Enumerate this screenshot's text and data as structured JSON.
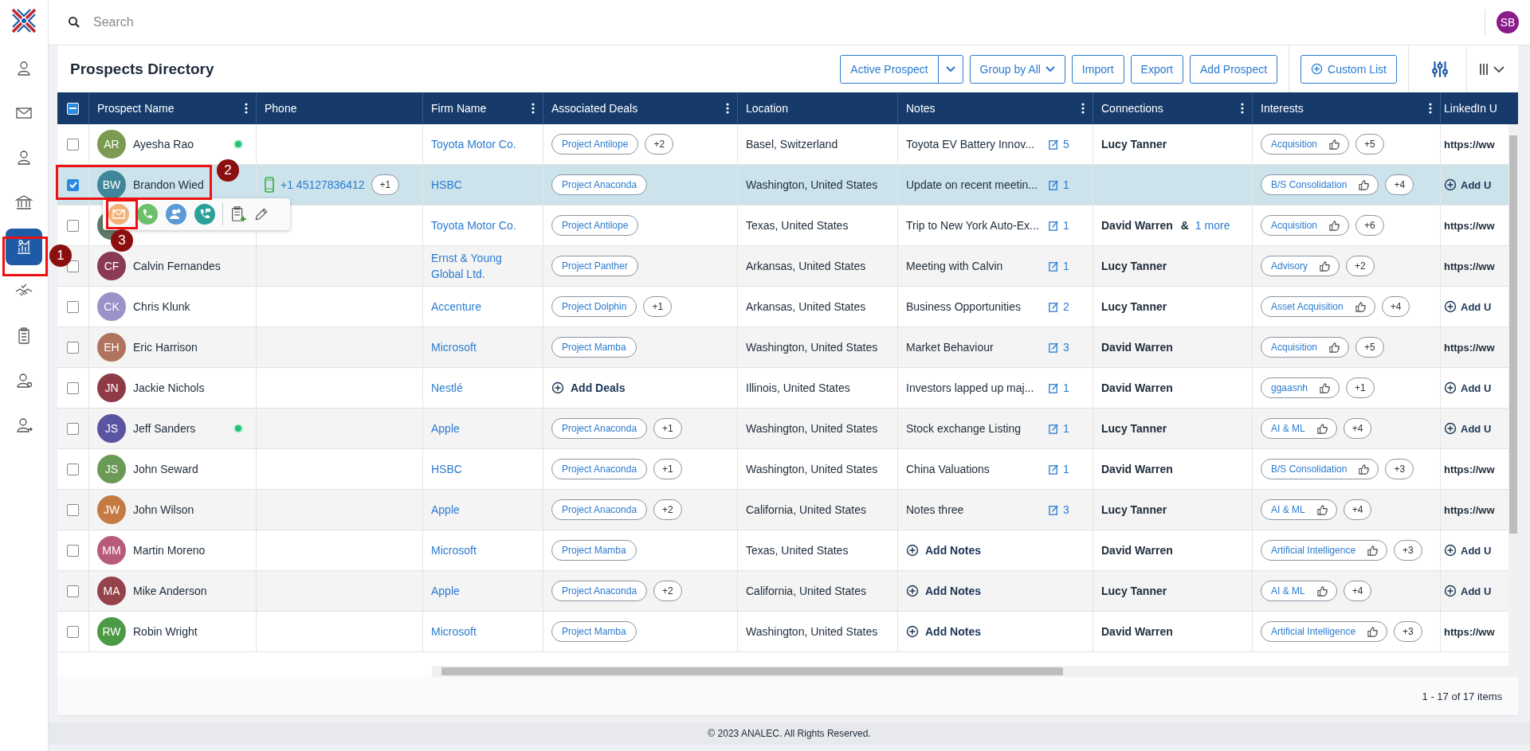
{
  "search": {
    "placeholder": "Search"
  },
  "user": {
    "initials": "SB"
  },
  "sidebar": {
    "items": [
      {
        "kind": "user-gear",
        "selected": false
      },
      {
        "kind": "mail",
        "selected": false
      },
      {
        "kind": "user",
        "selected": false
      },
      {
        "kind": "bank",
        "selected": false
      },
      {
        "kind": "chart",
        "selected": true
      },
      {
        "kind": "handshake",
        "selected": false
      },
      {
        "kind": "clipboard",
        "selected": false
      },
      {
        "kind": "user-settings",
        "selected": false
      },
      {
        "kind": "user-share",
        "selected": false
      }
    ]
  },
  "page": {
    "title": "Prospects Directory"
  },
  "toolbar": [
    {
      "kind": "split",
      "label": "Active Prospect"
    },
    {
      "kind": "dropdown",
      "label": "Group by All"
    },
    {
      "kind": "plain",
      "label": "Import"
    },
    {
      "kind": "plain",
      "label": "Export"
    },
    {
      "kind": "plain",
      "label": "Add Prospect"
    },
    {
      "kind": "add",
      "label": "Custom List"
    },
    {
      "kind": "filter"
    },
    {
      "kind": "columns"
    }
  ],
  "table": {
    "header_partial": true,
    "columns": [
      {
        "label": "Prospect Name",
        "menu": true
      },
      {
        "label": "Phone",
        "menu": false
      },
      {
        "label": "Firm Name",
        "menu": true
      },
      {
        "label": "Associated Deals",
        "menu": true
      },
      {
        "label": "Location",
        "menu": false
      },
      {
        "label": "Notes",
        "menu": true
      },
      {
        "label": "Connections",
        "menu": true
      },
      {
        "label": "Interests",
        "menu": true
      },
      {
        "label": "LinkedIn U",
        "menu": false
      }
    ],
    "rows": [
      {
        "checked": false,
        "initials": "AR",
        "color": "#7b9b50",
        "name": "Ayesha Rao",
        "online": true,
        "firm": "Toyota Motor Co.",
        "deal": "Project Antilope",
        "deal_more": "+2",
        "location": "Basel, Switzerland",
        "note": "Toyota EV Battery Innov...",
        "note_count": "5",
        "connection": "Lucy Tanner",
        "interest": "Acquisition",
        "interest_more": "+5",
        "linkedin": {
          "kind": "url",
          "text": "https://ww"
        }
      },
      {
        "checked": true,
        "initials": "BW",
        "color": "#3f8798",
        "name": "Brandon Wied",
        "online": false,
        "phone": "+1 45127836412",
        "phone_more": "+1",
        "firm": "HSBC",
        "deal": "Project Anaconda",
        "location": "Washington, United States",
        "note": "Update on recent meetin...",
        "note_count": "1",
        "interest": "B/S Consolidation",
        "interest_more": "+4",
        "linkedin": {
          "kind": "add",
          "text": "Add U"
        }
      },
      {
        "checked": false,
        "color": "#5f7a6a",
        "online": false,
        "firm": "Toyota Motor Co.",
        "deal": "Project Antilope",
        "location": "Texas, United States",
        "note": "Trip to New York Auto-Ex...",
        "note_count": "1",
        "connection": "David Warren",
        "connection_more": {
          "joiner": "&",
          "link": "1 more"
        },
        "interest": "Acquisition",
        "interest_more": "+6",
        "linkedin": {
          "kind": "url",
          "text": "https://ww"
        }
      },
      {
        "checked": false,
        "initials": "CF",
        "color": "#8a3a55",
        "name": "Calvin Fernandes",
        "online": false,
        "firm": "Ernst & Young Global Ltd.",
        "deal": "Project Panther",
        "location": "Arkansas, United States",
        "note": "Meeting with Calvin",
        "note_count": "1",
        "connection": "Lucy Tanner",
        "interest": "Advisory",
        "interest_more": "+2",
        "linkedin": {
          "kind": "url",
          "text": "https://ww"
        }
      },
      {
        "checked": false,
        "initials": "CK",
        "color": "#9a92c8",
        "name": "Chris Klunk",
        "online": false,
        "firm": "Accenture",
        "deal": "Project Dolphin",
        "deal_more": "+1",
        "location": "Arkansas, United States",
        "note": "Business Opportunities",
        "note_count": "2",
        "connection": "Lucy Tanner",
        "interest": "Asset Acquisition",
        "interest_more": "+4",
        "linkedin": {
          "kind": "add",
          "text": "Add U"
        }
      },
      {
        "checked": false,
        "initials": "EH",
        "color": "#b0735e",
        "name": "Eric Harrison",
        "online": false,
        "firm": "Microsoft",
        "deal": "Project Mamba",
        "location": "Washington, United States",
        "note": "Market Behaviour",
        "note_count": "3",
        "connection": "David Warren",
        "interest": "Acquisition",
        "interest_more": "+5",
        "linkedin": {
          "kind": "url",
          "text": "https://ww"
        }
      },
      {
        "checked": false,
        "initials": "JN",
        "color": "#8e3b45",
        "name": "Jackie Nichols",
        "online": false,
        "firm": "Nestlé",
        "deal_add": "Add Deals",
        "location": "Illinois, United States",
        "note": "Investors lapped up maj...",
        "note_count": "1",
        "connection": "David Warren",
        "interest": "ggaasnh",
        "interest_more": "+1",
        "linkedin": {
          "kind": "add",
          "text": "Add U"
        }
      },
      {
        "checked": false,
        "initials": "JS",
        "color": "#5a55a0",
        "name": "Jeff Sanders",
        "online": true,
        "firm": "Apple",
        "deal": "Project Anaconda",
        "deal_more": "+1",
        "location": "Washington, United States",
        "note": "Stock exchange Listing",
        "note_count": "1",
        "connection": "Lucy Tanner",
        "interest": "AI & ML",
        "interest_more": "+4",
        "linkedin": {
          "kind": "add",
          "text": "Add U"
        }
      },
      {
        "checked": false,
        "initials": "JS",
        "color": "#6b9a57",
        "name": "John Seward",
        "online": false,
        "firm": "HSBC",
        "deal": "Project Anaconda",
        "deal_more": "+1",
        "location": "Washington, United States",
        "note": "China Valuations",
        "note_count": "1",
        "connection": "David Warren",
        "interest": "B/S Consolidation",
        "interest_more": "+3",
        "linkedin": {
          "kind": "url",
          "text": "https://ww"
        }
      },
      {
        "checked": false,
        "initials": "JW",
        "color": "#c47a42",
        "name": "John Wilson",
        "online": false,
        "firm": "Apple",
        "deal": "Project Anaconda",
        "deal_more": "+2",
        "location": "California, United States",
        "note": "Notes three",
        "note_count": "3",
        "connection": "Lucy Tanner",
        "interest": "AI & ML",
        "interest_more": "+4",
        "linkedin": {
          "kind": "url",
          "text": "https://ww"
        }
      },
      {
        "checked": false,
        "initials": "MM",
        "color": "#b85a7a",
        "name": "Martin Moreno",
        "online": false,
        "firm": "Microsoft",
        "deal": "Project Mamba",
        "location": "Texas, United States",
        "note_add": "Add Notes",
        "connection": "David Warren",
        "interest": "Artificial Intelligence",
        "interest_more": "+3",
        "linkedin": {
          "kind": "add",
          "text": "Add U"
        }
      },
      {
        "checked": false,
        "initials": "MA",
        "color": "#94434a",
        "name": "Mike Anderson",
        "online": false,
        "firm": "Apple",
        "deal": "Project Anaconda",
        "deal_more": "+2",
        "location": "California, United States",
        "note_add": "Add Notes",
        "connection": "Lucy Tanner",
        "interest": "AI & ML",
        "interest_more": "+4",
        "linkedin": {
          "kind": "add",
          "text": "Add U"
        }
      },
      {
        "checked": false,
        "initials": "RW",
        "color": "#4d9a45",
        "name": "Robin Wright",
        "online": false,
        "firm": "Microsoft",
        "deal": "Project Mamba",
        "location": "Washington, United States",
        "note_add": "Add Notes",
        "connection": "David Warren",
        "interest": "Artificial Intelligence",
        "interest_more": "+3",
        "linkedin": {
          "kind": "url",
          "text": "https://ww"
        }
      }
    ]
  },
  "row_actions": [
    {
      "kind": "email"
    },
    {
      "kind": "phone"
    },
    {
      "kind": "contacts"
    },
    {
      "kind": "call"
    },
    {
      "kind": "add-note"
    },
    {
      "kind": "edit"
    }
  ],
  "pagination": {
    "text": "1 - 17 of 17 items"
  },
  "annotations": [
    {
      "label": "1"
    },
    {
      "label": "2"
    },
    {
      "label": "3"
    }
  ],
  "footer": {
    "text": "© 2023 ANALEC. All Rights Reserved."
  }
}
